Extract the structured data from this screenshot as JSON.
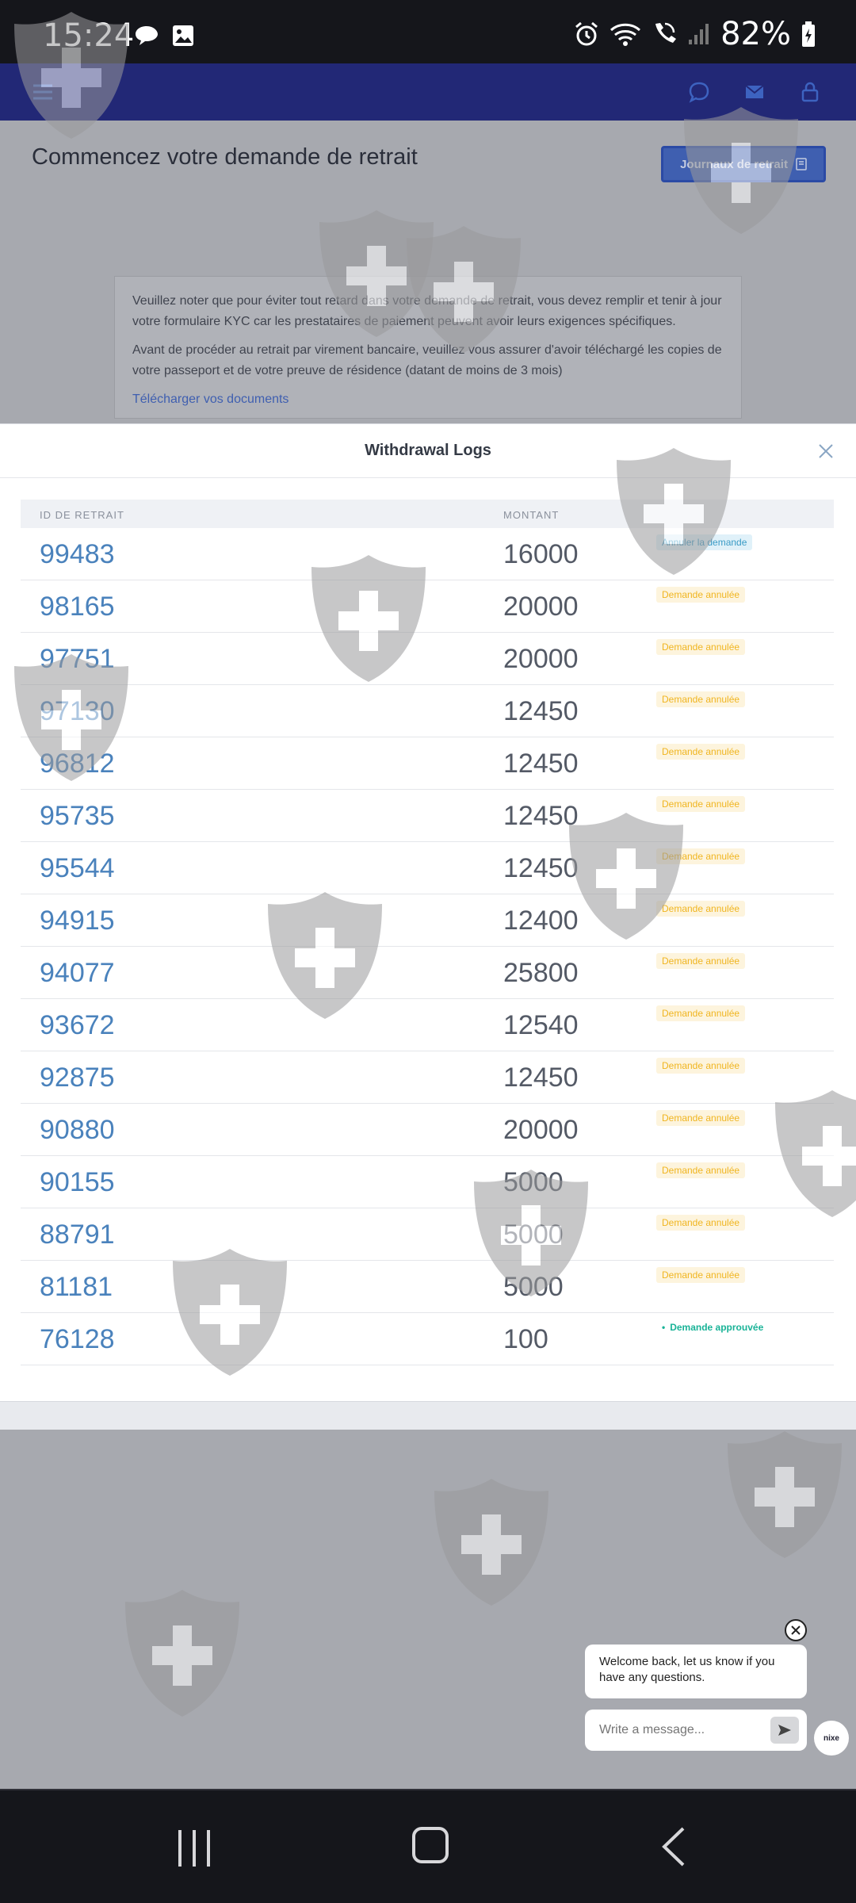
{
  "status_bar": {
    "time": "15:24",
    "battery": "82%",
    "icons": [
      "chat-bubble-icon",
      "image-icon",
      "alarm-icon",
      "wifi-icon",
      "wifi-call-icon",
      "signal-icon",
      "battery-charging-icon"
    ]
  },
  "header": {
    "icons": [
      "menu-icon",
      "chat-icon",
      "mail-icon",
      "lock-icon"
    ]
  },
  "page": {
    "title": "Commencez votre demande de retrait",
    "logs_button": "Journaux de retrait",
    "notice": {
      "p1": "Veuillez noter que pour éviter tout retard dans votre demande de retrait, vous devez remplir et tenir à jour votre formulaire KYC car les prestataires de paiement peuvent avoir leurs exigences spécifiques.",
      "p2": "Avant de procéder au retrait par virement bancaire, veuillez vous assurer d'avoir téléchargé les copies de votre passeport et de votre preuve de résidence (datant de moins de 3 mois)",
      "link": "Télécharger vos documents"
    }
  },
  "modal": {
    "title": "Withdrawal Logs",
    "columns": {
      "id": "ID DE RETRAIT",
      "amount": "MONTANT"
    },
    "rows": [
      {
        "id": "99483",
        "amount": "16000",
        "status": "Annuler la demande",
        "kind": "cancel"
      },
      {
        "id": "98165",
        "amount": "20000",
        "status": "Demande annulée",
        "kind": "cancelled"
      },
      {
        "id": "97751",
        "amount": "20000",
        "status": "Demande annulée",
        "kind": "cancelled"
      },
      {
        "id": "97130",
        "amount": "12450",
        "status": "Demande annulée",
        "kind": "cancelled"
      },
      {
        "id": "96812",
        "amount": "12450",
        "status": "Demande annulée",
        "kind": "cancelled"
      },
      {
        "id": "95735",
        "amount": "12450",
        "status": "Demande annulée",
        "kind": "cancelled"
      },
      {
        "id": "95544",
        "amount": "12450",
        "status": "Demande annulée",
        "kind": "cancelled"
      },
      {
        "id": "94915",
        "amount": "12400",
        "status": "Demande annulée",
        "kind": "cancelled"
      },
      {
        "id": "94077",
        "amount": "25800",
        "status": "Demande annulée",
        "kind": "cancelled"
      },
      {
        "id": "93672",
        "amount": "12540",
        "status": "Demande annulée",
        "kind": "cancelled"
      },
      {
        "id": "92875",
        "amount": "12450",
        "status": "Demande annulée",
        "kind": "cancelled"
      },
      {
        "id": "90880",
        "amount": "20000",
        "status": "Demande annulée",
        "kind": "cancelled"
      },
      {
        "id": "90155",
        "amount": "5000",
        "status": "Demande annulée",
        "kind": "cancelled"
      },
      {
        "id": "88791",
        "amount": "5000",
        "status": "Demande annulée",
        "kind": "cancelled"
      },
      {
        "id": "81181",
        "amount": "5000",
        "status": "Demande annulée",
        "kind": "cancelled"
      },
      {
        "id": "76128",
        "amount": "100",
        "status": "Demande approuvée",
        "kind": "approved"
      }
    ]
  },
  "chat": {
    "welcome": "Welcome back, let us know if you have any questions.",
    "placeholder": "Write a message...",
    "avatar_label": "nixe"
  },
  "colors": {
    "header": "#222876",
    "link": "#4a82bc",
    "cancelled": "#f0b520",
    "approved": "#19b397",
    "cancel_action": "#3a9bc6"
  }
}
